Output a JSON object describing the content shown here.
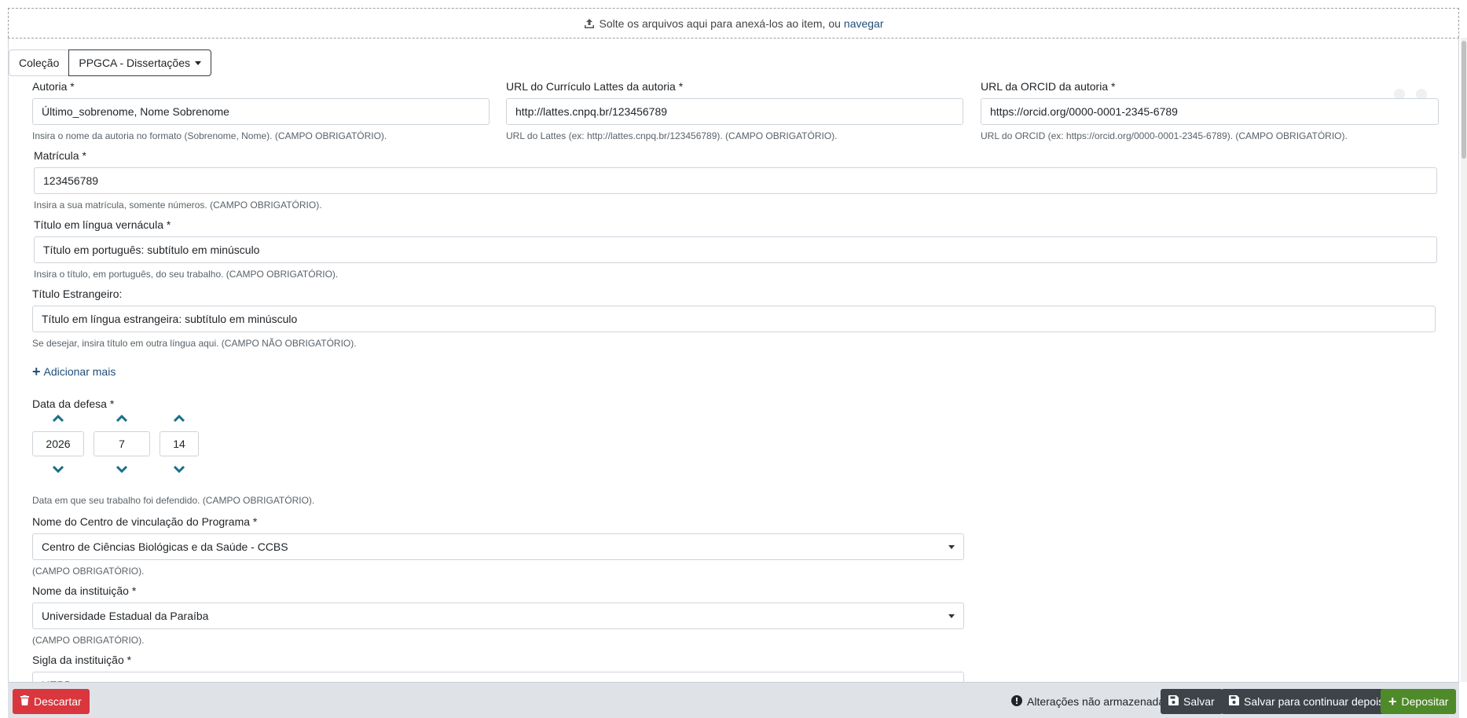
{
  "dropzone": {
    "text": "Solte os arquivos aqui para anexá-los ao item, ou",
    "link": "navegar"
  },
  "collection": {
    "label": "Coleção",
    "selected": "PPGCA - Dissertações"
  },
  "fields": {
    "autoria": {
      "label": "Autoria *",
      "value": "Último_sobrenome, Nome Sobrenome",
      "help": "Insira o nome da autoria no formato (Sobrenome, Nome). (CAMPO OBRIGATÓRIO)."
    },
    "lattes": {
      "label": "URL do Currículo Lattes da autoria *",
      "value": "http://lattes.cnpq.br/123456789",
      "help": "URL do Lattes (ex: http://lattes.cnpq.br/123456789). (CAMPO OBRIGATÓRIO)."
    },
    "orcid": {
      "label": "URL da ORCID da autoria *",
      "value": "https://orcid.org/0000-0001-2345-6789",
      "help": "URL do ORCID (ex: https://orcid.org/0000-0001-2345-6789). (CAMPO OBRIGATÓRIO)."
    },
    "matricula": {
      "label": "Matrícula *",
      "value": "123456789",
      "help": "Insira a sua matrícula, somente números. (CAMPO OBRIGATÓRIO)."
    },
    "titulo": {
      "label": "Título em língua vernácula *",
      "value": "Título em português: subtítulo em minúsculo",
      "help": "Insira o título, em português, do seu trabalho. (CAMPO OBRIGATÓRIO)."
    },
    "titulo_estrangeiro": {
      "label": "Título Estrangeiro:",
      "value": "Título em língua estrangeira: subtítulo em minúsculo",
      "help": "Se desejar, insira título em outra língua aqui. (CAMPO NÃO OBRIGATÓRIO)."
    },
    "add_more": "Adicionar mais",
    "data_defesa": {
      "label": "Data da defesa *",
      "year": "2026",
      "month": "7",
      "day": "14",
      "help": "Data em que seu trabalho foi defendido. (CAMPO OBRIGATÓRIO)."
    },
    "centro": {
      "label": "Nome do Centro de vinculação do Programa *",
      "value": "Centro de Ciências Biológicas e da Saúde - CCBS",
      "help": "(CAMPO OBRIGATÓRIO)."
    },
    "instituicao": {
      "label": "Nome da instituição *",
      "value": "Universidade Estadual da Paraíba",
      "help": "(CAMPO OBRIGATÓRIO)."
    },
    "sigla": {
      "label": "Sigla da instituição *",
      "value": "UEPB"
    }
  },
  "footer": {
    "discard": "Descartar",
    "unsaved": "Alterações não armazenadas",
    "save": "Salvar",
    "save_later": "Salvar para continuar depois",
    "deposit": "Depositar"
  },
  "colors": {
    "accent_link": "#1f4e79",
    "chevron": "#1a6f8a",
    "danger": "#d9363e",
    "dark": "#3d4349",
    "success": "#4f8a2a"
  }
}
